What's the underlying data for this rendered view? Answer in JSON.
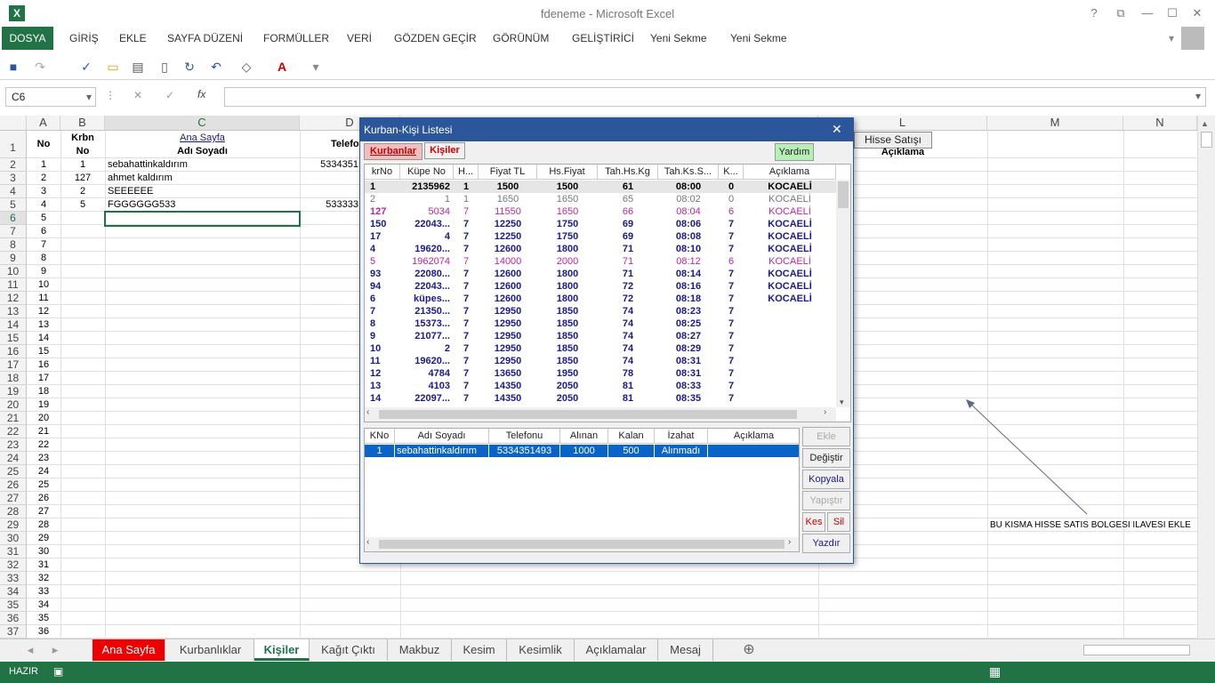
{
  "window": {
    "title": "fdeneme - Microsoft Excel",
    "help": "?",
    "restore": "⧉",
    "minimize": "—",
    "maximize": "☐",
    "close": "✕"
  },
  "ribbon": {
    "file": "DOSYA",
    "tabs": [
      "GİRİŞ",
      "EKLE",
      "SAYFA DÜZENİ",
      "FORMÜLLER",
      "VERİ",
      "GÖZDEN GEÇİR",
      "GÖRÜNÜM",
      "GELİŞTİRİCİ",
      "Yeni Sekme",
      "Yeni Sekme"
    ]
  },
  "formula_bar": {
    "name_box": "C6",
    "fx": "fx",
    "cancel": "✕",
    "enter": "✓",
    "value": ""
  },
  "columns": [
    "A",
    "B",
    "C",
    "D",
    "L",
    "M",
    "N"
  ],
  "rows": [
    "1",
    "2",
    "3",
    "4",
    "5",
    "6",
    "7",
    "8",
    "9",
    "10",
    "11",
    "12",
    "13",
    "14",
    "15",
    "16",
    "17",
    "18",
    "19",
    "20",
    "21",
    "22",
    "23",
    "24",
    "25",
    "26",
    "27",
    "28",
    "29",
    "30",
    "31",
    "32",
    "33",
    "34",
    "35",
    "36",
    "37"
  ],
  "sheet": {
    "header": {
      "no": "No",
      "krbn_no_1": "Krbn",
      "krbn_no_2": "No",
      "ana_sayfa_link": "Ana Sayfa",
      "adi_soyadi": "Adı Soyadı",
      "telefon": "Telefo",
      "hisse_button": "Hisse Satışı",
      "aciklama": "Açıklama"
    },
    "data": [
      {
        "no": "1",
        "krbn": "1",
        "name": "sebahattinkaldırım",
        "tel": "5334351"
      },
      {
        "no": "2",
        "krbn": "127",
        "name": "ahmet kaldırım",
        "tel": ""
      },
      {
        "no": "3",
        "krbn": "2",
        "name": "SEEEEEE",
        "tel": ""
      },
      {
        "no": "4",
        "krbn": "5",
        "name": "FGGGGGG533",
        "tel": "533333"
      }
    ],
    "a_numbers": [
      "5",
      "6",
      "7",
      "8",
      "9",
      "10",
      "11",
      "12",
      "13",
      "14",
      "15",
      "16",
      "17",
      "18",
      "19",
      "20",
      "21",
      "22",
      "23",
      "24",
      "25",
      "26",
      "27",
      "28",
      "29",
      "30",
      "31",
      "32",
      "33",
      "34",
      "35",
      "36"
    ],
    "annotation": "BU KISMA HISSE SATIS BOLGESI ILAVESI EKLE"
  },
  "sheet_tabs": [
    "Ana Sayfa",
    "Kurbanlıklar",
    "Kişiler",
    "Kağıt Çıktı",
    "Makbuz",
    "Kesim",
    "Kesimlik",
    "Açıklamalar",
    "Mesaj"
  ],
  "status": {
    "ready": "HAZIR"
  },
  "dialog": {
    "title": "Kurban-Kişi Listesi",
    "close": "✕",
    "tab_kurbanlar": "Kurbanlar",
    "tab_kisiler": "Kişiler",
    "help_button": "Yardım",
    "top_columns": [
      "krNo",
      "Küpe No",
      "H...",
      "Fiyat TL",
      "Hs.Fiyat",
      "Tah.Hs.Kg",
      "Tah.Ks.S...",
      "K...",
      "Açıklama"
    ],
    "top_rows": [
      {
        "c": [
          "1",
          "2135962",
          "1",
          "1500",
          "1500",
          "61",
          "08:00",
          "0",
          "KOCAELİ"
        ],
        "style": "black"
      },
      {
        "c": [
          "2",
          "1",
          "1",
          "1650",
          "1650",
          "65",
          "08:02",
          "0",
          "KOCAELİ"
        ],
        "style": "gray"
      },
      {
        "c": [
          "127",
          "5034",
          "7",
          "11550",
          "1650",
          "66",
          "08:04",
          "6",
          "KOCAELİ"
        ],
        "style": "magenta"
      },
      {
        "c": [
          "150",
          "22043...",
          "7",
          "12250",
          "1750",
          "69",
          "08:06",
          "7",
          "KOCAELİ"
        ],
        "style": "navy"
      },
      {
        "c": [
          "17",
          "4",
          "7",
          "12250",
          "1750",
          "69",
          "08:08",
          "7",
          "KOCAELİ"
        ],
        "style": "navy"
      },
      {
        "c": [
          "4",
          "19620...",
          "7",
          "12600",
          "1800",
          "71",
          "08:10",
          "7",
          "KOCAELİ"
        ],
        "style": "navy"
      },
      {
        "c": [
          "5",
          "1962074",
          "7",
          "14000",
          "2000",
          "71",
          "08:12",
          "6",
          "KOCAELİ"
        ],
        "style": "magenta"
      },
      {
        "c": [
          "93",
          "22080...",
          "7",
          "12600",
          "1800",
          "71",
          "08:14",
          "7",
          "KOCAELİ"
        ],
        "style": "navy"
      },
      {
        "c": [
          "94",
          "22043...",
          "7",
          "12600",
          "1800",
          "72",
          "08:16",
          "7",
          "KOCAELİ"
        ],
        "style": "navy"
      },
      {
        "c": [
          "6",
          "küpes...",
          "7",
          "12600",
          "1800",
          "72",
          "08:18",
          "7",
          "KOCAELİ"
        ],
        "style": "navy"
      },
      {
        "c": [
          "7",
          "21350...",
          "7",
          "12950",
          "1850",
          "74",
          "08:23",
          "7",
          ""
        ],
        "style": "navy"
      },
      {
        "c": [
          "8",
          "15373...",
          "7",
          "12950",
          "1850",
          "74",
          "08:25",
          "7",
          ""
        ],
        "style": "navy"
      },
      {
        "c": [
          "9",
          "21077...",
          "7",
          "12950",
          "1850",
          "74",
          "08:27",
          "7",
          ""
        ],
        "style": "navy"
      },
      {
        "c": [
          "10",
          "2",
          "7",
          "12950",
          "1850",
          "74",
          "08:29",
          "7",
          ""
        ],
        "style": "navy"
      },
      {
        "c": [
          "11",
          "19620...",
          "7",
          "12950",
          "1850",
          "74",
          "08:31",
          "7",
          ""
        ],
        "style": "navy"
      },
      {
        "c": [
          "12",
          "4784",
          "7",
          "13650",
          "1950",
          "78",
          "08:31",
          "7",
          ""
        ],
        "style": "navy"
      },
      {
        "c": [
          "13",
          "4103",
          "7",
          "14350",
          "2050",
          "81",
          "08:33",
          "7",
          ""
        ],
        "style": "navy"
      },
      {
        "c": [
          "14",
          "22097...",
          "7",
          "14350",
          "2050",
          "81",
          "08:35",
          "7",
          ""
        ],
        "style": "navy"
      }
    ],
    "bottom_columns": [
      "KNo",
      "Adı Soyadı",
      "Telefonu",
      "Alınan",
      "Kalan",
      "İzahat",
      "Açıklama"
    ],
    "bottom_rows": [
      {
        "c": [
          "1",
          "sebahattinkaldırım",
          "5334351493",
          "1000",
          "500",
          "Alınmadı",
          ""
        ]
      }
    ],
    "buttons": {
      "ekle": "Ekle",
      "degistir": "Değiştir",
      "kopyala": "Kopyala",
      "yapistir": "Yapıştır",
      "kes": "Kes",
      "sil": "Sil",
      "yazdir": "Yazdır"
    }
  },
  "colors": {
    "excel_green": "#217346",
    "dialog_blue": "#2b579a",
    "navy_text": "#1a1a8c",
    "magenta_text": "#c0249a",
    "selection": "#0a64c8"
  }
}
